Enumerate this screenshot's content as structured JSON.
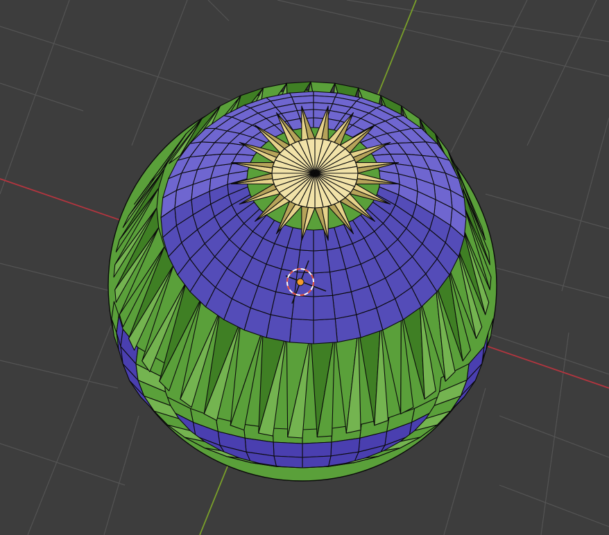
{
  "viewport": {
    "background": "#3d3d3d",
    "grid_color": "#545454",
    "axis_x_color": "#b3353f",
    "axis_y_color": "#7aa02a",
    "wire_color": "#0a0a0a"
  },
  "mesh": {
    "name": "sphere",
    "segments": 40,
    "colors": {
      "cap_blue": "#6f66d0",
      "cap_blue_dark": "#544cb8",
      "band_blue": "#4a3fb0",
      "green": "#5aa03a",
      "green_dark": "#3f7f24",
      "green_light": "#74b450",
      "star": "#e6d28a",
      "star_dark": "#b6a35a",
      "center": "#f1e2a8"
    }
  },
  "origin": {
    "name": "object-origin",
    "color": "#f39b2c"
  },
  "cursor_3d": {
    "name": "3d-cursor",
    "ring_color": "#e24a3a",
    "ring_alt_color": "#ffffff"
  }
}
